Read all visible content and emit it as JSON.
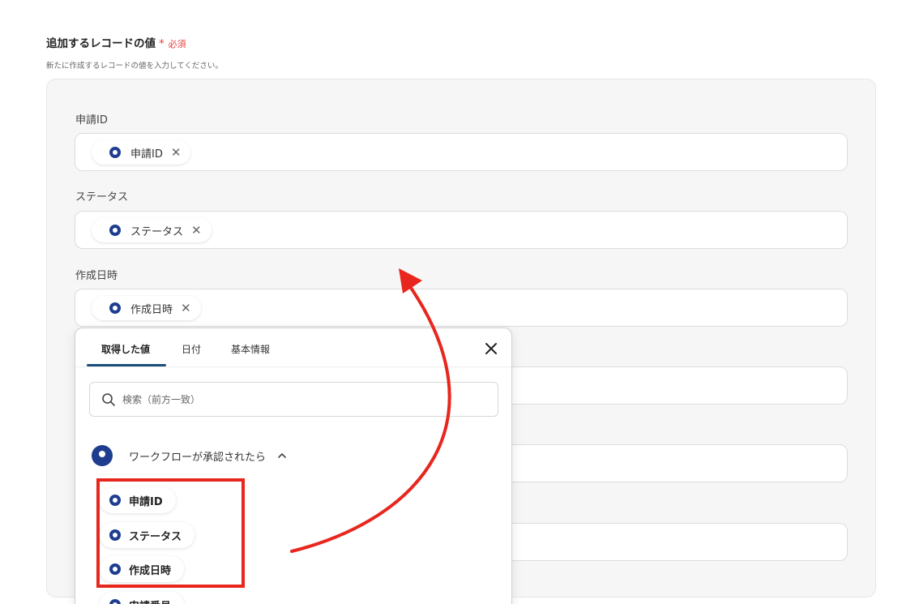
{
  "section": {
    "title": "追加するレコードの値",
    "required_star": "*",
    "required_text": "必須",
    "description": "新たに作成するレコードの値を入力してください。"
  },
  "fields": [
    {
      "label": "申請ID",
      "chip": "申請ID"
    },
    {
      "label": "ステータス",
      "chip": "ステータス"
    },
    {
      "label": "作成日時",
      "chip": "作成日時"
    }
  ],
  "popup": {
    "tabs": [
      "取得した値",
      "日付",
      "基本情報"
    ],
    "active_tab": "取得した値",
    "search_placeholder": "検索（前方一致）",
    "group_label": "ワークフローが承認されたら",
    "items": [
      "申請ID",
      "ステータス",
      "作成日時",
      "申請番号"
    ]
  },
  "colors": {
    "accent": "#1f3d8f",
    "required": "#e8413d",
    "annotation": "#e8261d"
  }
}
